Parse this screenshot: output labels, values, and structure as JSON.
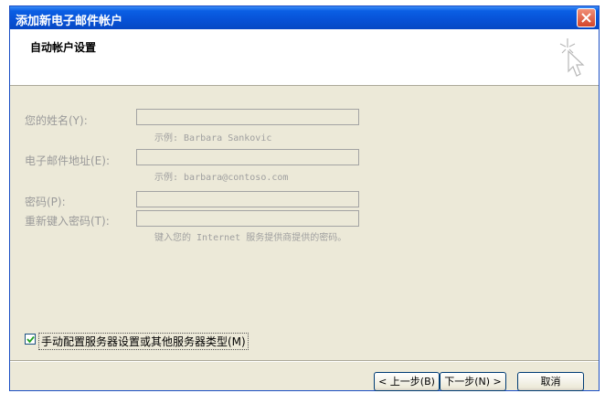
{
  "window": {
    "title": "添加新电子邮件帐户"
  },
  "header": {
    "title": "自动帐户设置"
  },
  "form": {
    "name_label": "您的姓名(Y):",
    "name_hint": "示例: Barbara Sankovic",
    "email_label": "电子邮件地址(E):",
    "email_hint": "示例: barbara@contoso.com",
    "password_label": "密码(P):",
    "retype_label": "重新键入密码(T):",
    "password_hint": "键入您的 Internet 服务提供商提供的密码。"
  },
  "manual_config": {
    "label": "手动配置服务器设置或其他服务器类型(M)",
    "checked": true
  },
  "buttons": {
    "back": "< 上一步(B)",
    "next": "下一步(N) >",
    "cancel": "取消"
  }
}
